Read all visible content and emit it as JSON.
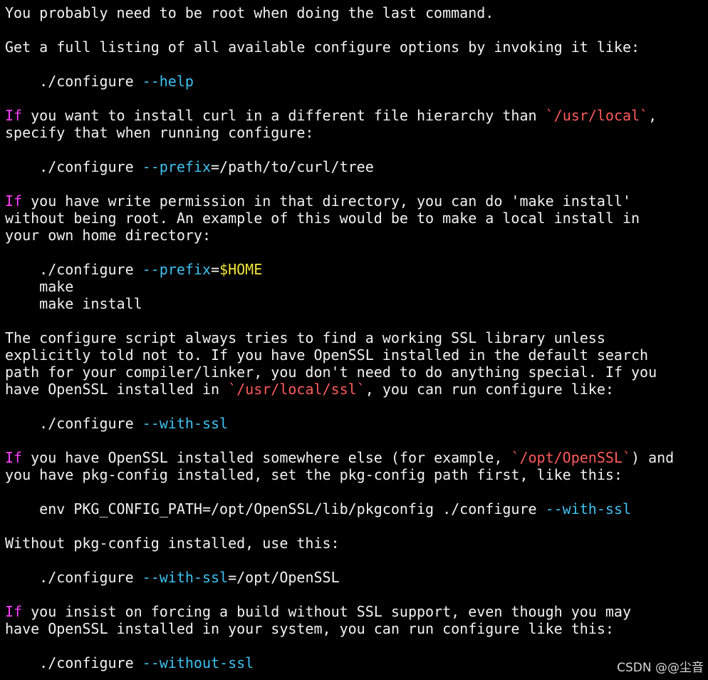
{
  "colors": {
    "background": "#000000",
    "plain": "#f2f2f2",
    "keyword": "#ff40ff",
    "path": "#ff5a5a",
    "option": "#3fc1f0",
    "variable": "#f2e636"
  },
  "terminal": {
    "lines": [
      [
        {
          "t": "You probably need to be root when doing the last command.",
          "c": "plain"
        }
      ],
      [],
      [
        {
          "t": "Get a full listing of all available configure options by invoking it like:",
          "c": "plain"
        }
      ],
      [],
      [
        {
          "t": "    ./configure ",
          "c": "plain"
        },
        {
          "t": "--help",
          "c": "option"
        }
      ],
      [],
      [
        {
          "t": "If",
          "c": "keyword"
        },
        {
          "t": " you want to install curl in a different file hierarchy than ",
          "c": "plain"
        },
        {
          "t": "`/usr/local`",
          "c": "path"
        },
        {
          "t": ",",
          "c": "plain"
        }
      ],
      [
        {
          "t": "specify that when running configure:",
          "c": "plain"
        }
      ],
      [],
      [
        {
          "t": "    ./configure ",
          "c": "plain"
        },
        {
          "t": "--prefix",
          "c": "option"
        },
        {
          "t": "=/path/to/curl/tree",
          "c": "plain"
        }
      ],
      [],
      [
        {
          "t": "If",
          "c": "keyword"
        },
        {
          "t": " you have write permission in that directory, you can do 'make install'",
          "c": "plain"
        }
      ],
      [
        {
          "t": "without being root. An example of this would be to make a local install in",
          "c": "plain"
        }
      ],
      [
        {
          "t": "your own home directory:",
          "c": "plain"
        }
      ],
      [],
      [
        {
          "t": "    ./configure ",
          "c": "plain"
        },
        {
          "t": "--prefix",
          "c": "option"
        },
        {
          "t": "=",
          "c": "plain"
        },
        {
          "t": "$HOME",
          "c": "variable"
        }
      ],
      [
        {
          "t": "    make",
          "c": "plain"
        }
      ],
      [
        {
          "t": "    make install",
          "c": "plain"
        }
      ],
      [],
      [
        {
          "t": "The configure script always tries to find a working SSL library unless",
          "c": "plain"
        }
      ],
      [
        {
          "t": "explicitly told not to. If you have OpenSSL installed in the default search",
          "c": "plain"
        }
      ],
      [
        {
          "t": "path for your compiler/linker, you don't need to do anything special. If you",
          "c": "plain"
        }
      ],
      [
        {
          "t": "have OpenSSL installed in ",
          "c": "plain"
        },
        {
          "t": "`/usr/local/ssl`",
          "c": "path"
        },
        {
          "t": ", you can run configure like:",
          "c": "plain"
        }
      ],
      [],
      [
        {
          "t": "    ./configure ",
          "c": "plain"
        },
        {
          "t": "--with-ssl",
          "c": "option"
        }
      ],
      [],
      [
        {
          "t": "If",
          "c": "keyword"
        },
        {
          "t": " you have OpenSSL installed somewhere else (for example, ",
          "c": "plain"
        },
        {
          "t": "`/opt/OpenSSL`",
          "c": "path"
        },
        {
          "t": ") and",
          "c": "plain"
        }
      ],
      [
        {
          "t": "you have pkg-config installed, set the pkg-config path first, like this:",
          "c": "plain"
        }
      ],
      [],
      [
        {
          "t": "    env PKG_CONFIG_PATH=/opt/OpenSSL/lib/pkgconfig ./configure ",
          "c": "plain"
        },
        {
          "t": "--with-ssl",
          "c": "option"
        }
      ],
      [],
      [
        {
          "t": "Without pkg-config installed, use this:",
          "c": "plain"
        }
      ],
      [],
      [
        {
          "t": "    ./configure ",
          "c": "plain"
        },
        {
          "t": "--with-ssl",
          "c": "option"
        },
        {
          "t": "=/opt/OpenSSL",
          "c": "plain"
        }
      ],
      [],
      [
        {
          "t": "If",
          "c": "keyword"
        },
        {
          "t": " you insist on forcing a build without SSL support, even though you may",
          "c": "plain"
        }
      ],
      [
        {
          "t": "have OpenSSL installed in your system, you can run configure like this:",
          "c": "plain"
        }
      ],
      [],
      [
        {
          "t": "    ./configure ",
          "c": "plain"
        },
        {
          "t": "--without-ssl",
          "c": "option"
        }
      ]
    ]
  },
  "watermark": {
    "text": "CSDN @@尘音"
  }
}
